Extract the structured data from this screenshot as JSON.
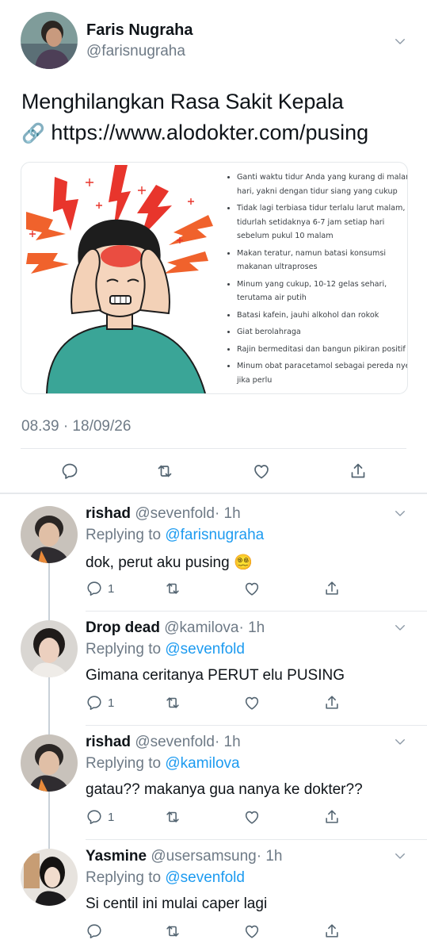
{
  "main_tweet": {
    "name": "Faris Nugraha",
    "handle": "@farisnugraha",
    "text_line1": "Menghilangkan Rasa Sakit Kepala",
    "link_emoji": "🔗",
    "link": "https://www.alodokter.com/pusing",
    "card_bullets": [
      "Ganti waktu tidur Anda yang kurang di malam hari, yakni dengan tidur siang yang cukup",
      "Tidak lagi terbiasa tidur terlalu larut malam, tidurlah setidaknya 6-7 jam setiap hari sebelum pukul 10 malam",
      "Makan teratur, namun batasi konsumsi makanan ultraproses",
      "Minum yang cukup, 10-12 gelas sehari, terutama air putih",
      "Batasi kafein, jauhi alkohol dan rokok",
      "Giat berolahraga",
      "Rajin bermeditasi dan bangun pikiran positif",
      "Minum obat paracetamol sebagai pereda nyeri jika perlu"
    ],
    "timestamp": "08.39 · 18/09/26"
  },
  "replies": [
    {
      "name": "rishad",
      "handle": "@sevenfold",
      "time": "· 1h",
      "replying_prefix": "Replying to",
      "replying_to": "@farisnugraha",
      "text": "dok, perut aku pusing 😵‍💫",
      "reply_count": "1"
    },
    {
      "name": "Drop dead",
      "handle": "@kamilova",
      "time": "· 1h",
      "replying_prefix": "Replying to",
      "replying_to": "@sevenfold",
      "text": "Gimana ceritanya PERUT elu PUSING",
      "reply_count": "1"
    },
    {
      "name": "rishad",
      "handle": "@sevenfold",
      "time": "· 1h",
      "replying_prefix": "Replying to",
      "replying_to": "@kamilova",
      "text": "gatau?? makanya gua nanya ke dokter??",
      "reply_count": "1"
    },
    {
      "name": "Yasmine",
      "handle": "@usersamsung",
      "time": "· 1h",
      "replying_prefix": "Replying to",
      "replying_to": "@sevenfold",
      "text": "Si centil ini mulai caper lagi",
      "reply_count": ""
    }
  ],
  "colors": {
    "link_blue": "#1d9bf0",
    "text": "#0f1419",
    "secondary": "#6e7a86",
    "divider": "#e6e9ec",
    "sweater": "#3aa597",
    "pain_red": "#e8352c",
    "lightning_orange": "#f0622c"
  },
  "icons": [
    "chevron-down-icon",
    "reply-icon",
    "retweet-icon",
    "like-icon",
    "share-icon",
    "link-icon"
  ]
}
